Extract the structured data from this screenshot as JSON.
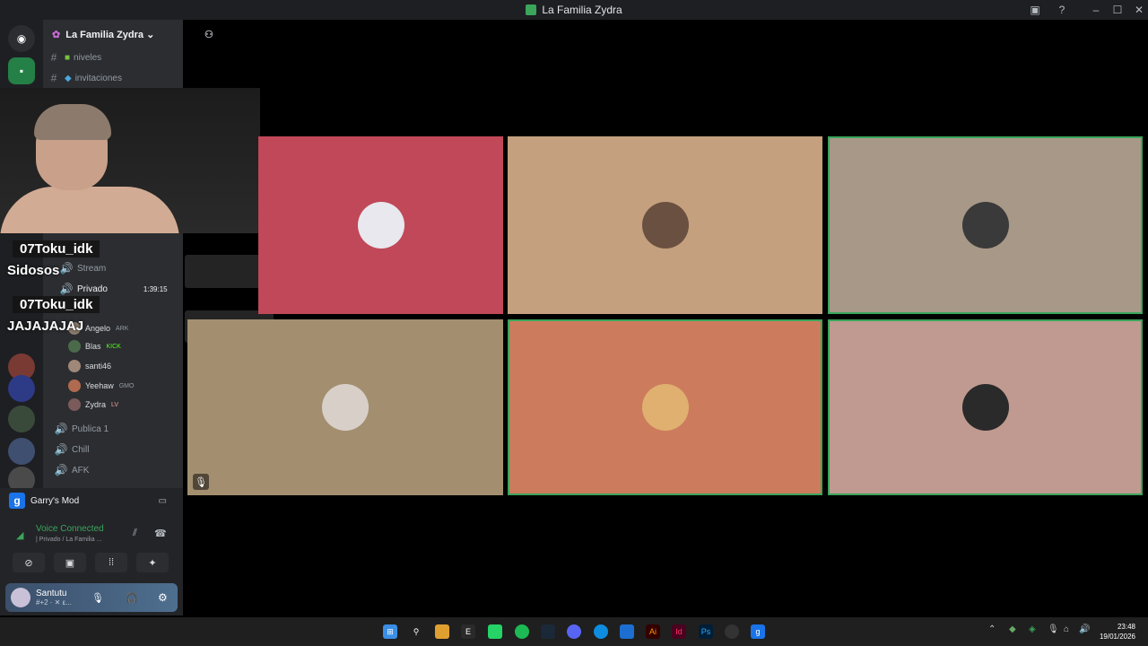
{
  "window": {
    "title": "La Familia Zydra",
    "minimize": "–",
    "maximize": "☐",
    "close": "✕"
  },
  "server": {
    "name": "La Familia Zydra ⌄"
  },
  "channels": [
    {
      "label": "niveles"
    },
    {
      "label": "invitaciones"
    },
    {
      "label": "Stream"
    },
    {
      "label": "Privado",
      "time": "1:39:15"
    }
  ],
  "members": [
    {
      "name": "Angelo",
      "badge": "ARK"
    },
    {
      "name": "Blas",
      "badge": "KICK"
    },
    {
      "name": "santi46"
    },
    {
      "name": "Yeehaw",
      "badge": "GMO"
    },
    {
      "name": "Zydra",
      "badge": "LV"
    }
  ],
  "voice_channels": [
    {
      "label": "Publica 1"
    },
    {
      "label": "Chill"
    },
    {
      "label": "AFK"
    }
  ],
  "chat_overlay": [
    {
      "user": "07Toku_idk",
      "message": "Sidosos"
    },
    {
      "user": "07Toku_idk",
      "message": "JAJAJAJAJ"
    }
  ],
  "activity": {
    "name": "Garry's Mod"
  },
  "voice": {
    "status": "Voice Connected",
    "channel": "| Privado / La Familia ..."
  },
  "user": {
    "name": "Santutu",
    "status": "#+2 · ✕ ε..."
  },
  "clock": {
    "time": "23:48",
    "date": "19/01/2026"
  },
  "colors": {
    "tile_stan": "#c04858",
    "tile_2": "#c4a07e",
    "tile_3": "#a89888",
    "tile_4": "#a38f70",
    "tile_5": "#cc7c5c",
    "tile_6": "#c09a90",
    "speaking": "#3ba55c"
  }
}
